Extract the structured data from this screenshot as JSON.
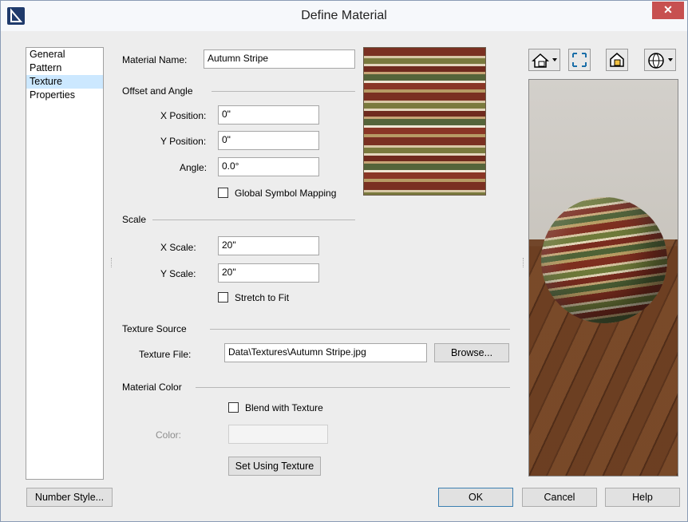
{
  "window": {
    "title": "Define Material",
    "close": "✕"
  },
  "nav": {
    "items": [
      "General",
      "Pattern",
      "Texture",
      "Properties"
    ],
    "selected": "Texture"
  },
  "material_name": {
    "label": "Material Name:",
    "value": "Autumn Stripe"
  },
  "offset_angle": {
    "section": "Offset and Angle",
    "x_label": "X Position:",
    "x_value": "0\"",
    "y_label": "Y Position:",
    "y_value": "0\"",
    "angle_label": "Angle:",
    "angle_value": "0.0°",
    "global_label": "Global Symbol Mapping",
    "global_checked": false
  },
  "scale": {
    "section": "Scale",
    "x_label": "X Scale:",
    "x_value": "20\"",
    "y_label": "Y Scale:",
    "y_value": "20\"",
    "stretch_label": "Stretch to Fit",
    "stretch_checked": false
  },
  "texture_source": {
    "section": "Texture Source",
    "file_label": "Texture File:",
    "file_value": "Data\\Textures\\Autumn Stripe.jpg",
    "browse_label": "Browse..."
  },
  "material_color": {
    "section": "Material Color",
    "blend_label": "Blend with Texture",
    "blend_checked": false,
    "color_label": "Color:",
    "set_using_label": "Set Using Texture"
  },
  "footer": {
    "number_style": "Number Style...",
    "ok": "OK",
    "cancel": "Cancel",
    "help": "Help"
  },
  "toolbar": {
    "icons": [
      "house-view-icon",
      "fit-view-icon",
      "material-preview-icon",
      "globe-lighting-icon"
    ]
  },
  "colors": {
    "selection": "#cce8ff",
    "close": "#c75050",
    "title_bg": "#f6f8fb"
  }
}
